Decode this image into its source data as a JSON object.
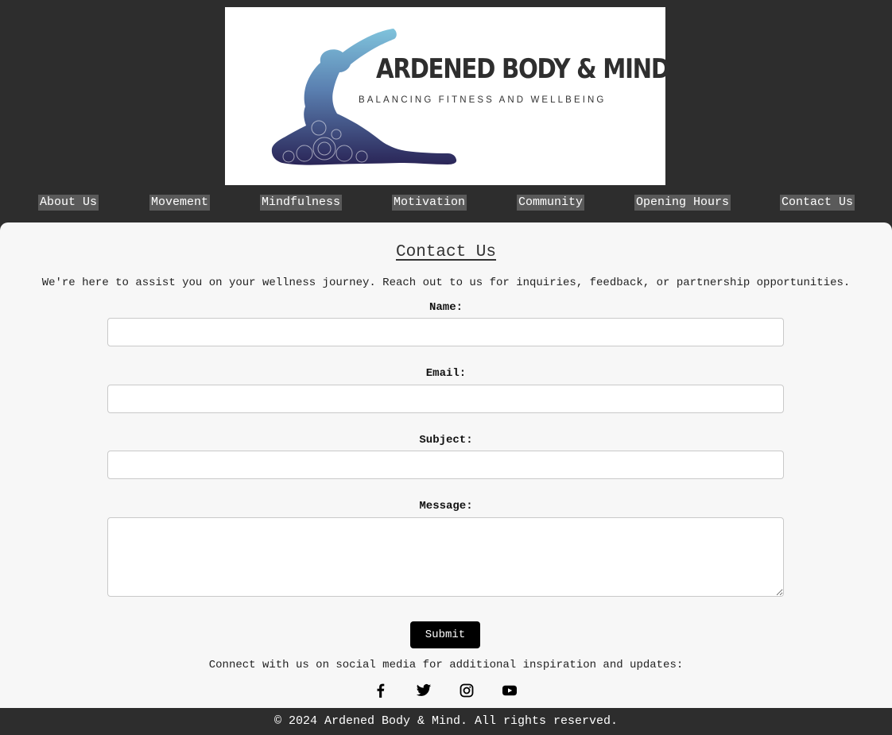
{
  "logo": {
    "title": "ARDENED BODY & MIND",
    "tagline": "BALANCING FITNESS AND WELLBEING",
    "icon": "yoga-figure-icon"
  },
  "nav": {
    "items": [
      {
        "label": "About Us"
      },
      {
        "label": "Movement"
      },
      {
        "label": "Mindfulness"
      },
      {
        "label": "Motivation"
      },
      {
        "label": "Community"
      },
      {
        "label": "Opening Hours"
      },
      {
        "label": "Contact Us"
      }
    ]
  },
  "main": {
    "title": "Contact Us",
    "intro": "We're here to assist you on your wellness journey. Reach out to us for inquiries, feedback, or partnership opportunities."
  },
  "form": {
    "name_label": "Name:",
    "name_value": "",
    "email_label": "Email:",
    "email_value": "",
    "subject_label": "Subject:",
    "subject_value": "",
    "message_label": "Message:",
    "message_value": "",
    "submit_label": "Submit"
  },
  "social": {
    "text": "Connect with us on social media for additional inspiration and updates:",
    "icons": [
      "facebook-icon",
      "twitter-icon",
      "instagram-icon",
      "youtube-icon"
    ]
  },
  "footer": {
    "text": "© 2024 Ardened Body & Mind. All rights reserved."
  },
  "colors": {
    "header_bg": "#2d2d2d",
    "nav_item_bg": "#5a5a5a",
    "main_bg": "#f7f7f7",
    "button_bg": "#000000",
    "logo_gradient_top": "#7bbcd8",
    "logo_gradient_bottom": "#2a2557"
  }
}
